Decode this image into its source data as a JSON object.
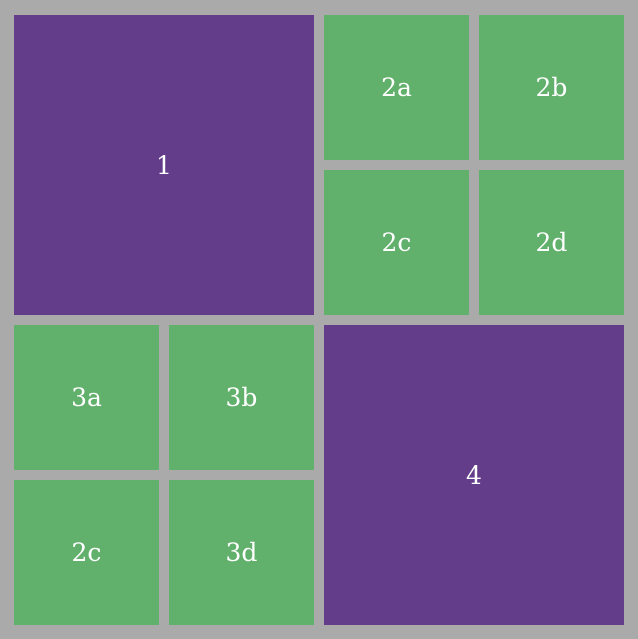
{
  "colors": {
    "background": "#aaaaaa",
    "purple": "#643d8a",
    "green": "#61b06b",
    "text": "#ffffff"
  },
  "blocks": {
    "b1": {
      "label": "1"
    },
    "b2": {
      "cells": [
        {
          "label": "2a"
        },
        {
          "label": "2b"
        },
        {
          "label": "2c"
        },
        {
          "label": "2d"
        }
      ]
    },
    "b3": {
      "cells": [
        {
          "label": "3a"
        },
        {
          "label": "3b"
        },
        {
          "label": "2c"
        },
        {
          "label": "3d"
        }
      ]
    },
    "b4": {
      "label": "4"
    }
  }
}
